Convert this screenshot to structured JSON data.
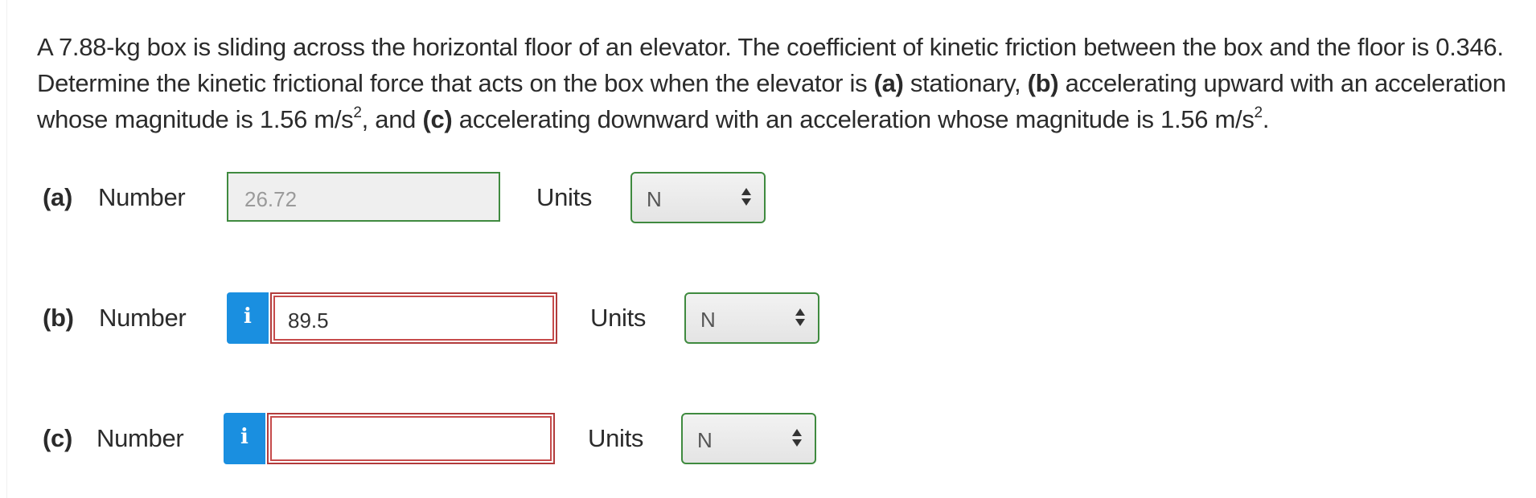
{
  "question": {
    "p1": "A 7.88-kg box is sliding across the horizontal floor of an elevator. The coefficient of kinetic friction between the box and the floor is 0.346. Determine the kinetic frictional force that acts on the box when the elevator is ",
    "a_tag": "(a)",
    "p2": " stationary, ",
    "b_tag": "(b)",
    "p3": " accelerating upward with an acceleration whose magnitude is 1.56 m/s",
    "sup1": "2",
    "p4": ", and ",
    "c_tag": "(c)",
    "p5": " accelerating downward with an acceleration whose magnitude is 1.56 m/s",
    "sup2": "2",
    "p6": "."
  },
  "parts": {
    "a": {
      "label": "(a)",
      "number_label": "Number",
      "value": "26.72",
      "units_label": "Units",
      "unit": "N"
    },
    "b": {
      "label": "(b)",
      "number_label": "Number",
      "info": "i",
      "value": "89.5",
      "units_label": "Units",
      "unit": "N"
    },
    "c": {
      "label": "(c)",
      "number_label": "Number",
      "info": "i",
      "value": "",
      "units_label": "Units",
      "unit": "N"
    }
  },
  "colors": {
    "correct_border": "#3f8a3f",
    "error_border": "#b23b3b",
    "info_button": "#1a8fe0"
  }
}
